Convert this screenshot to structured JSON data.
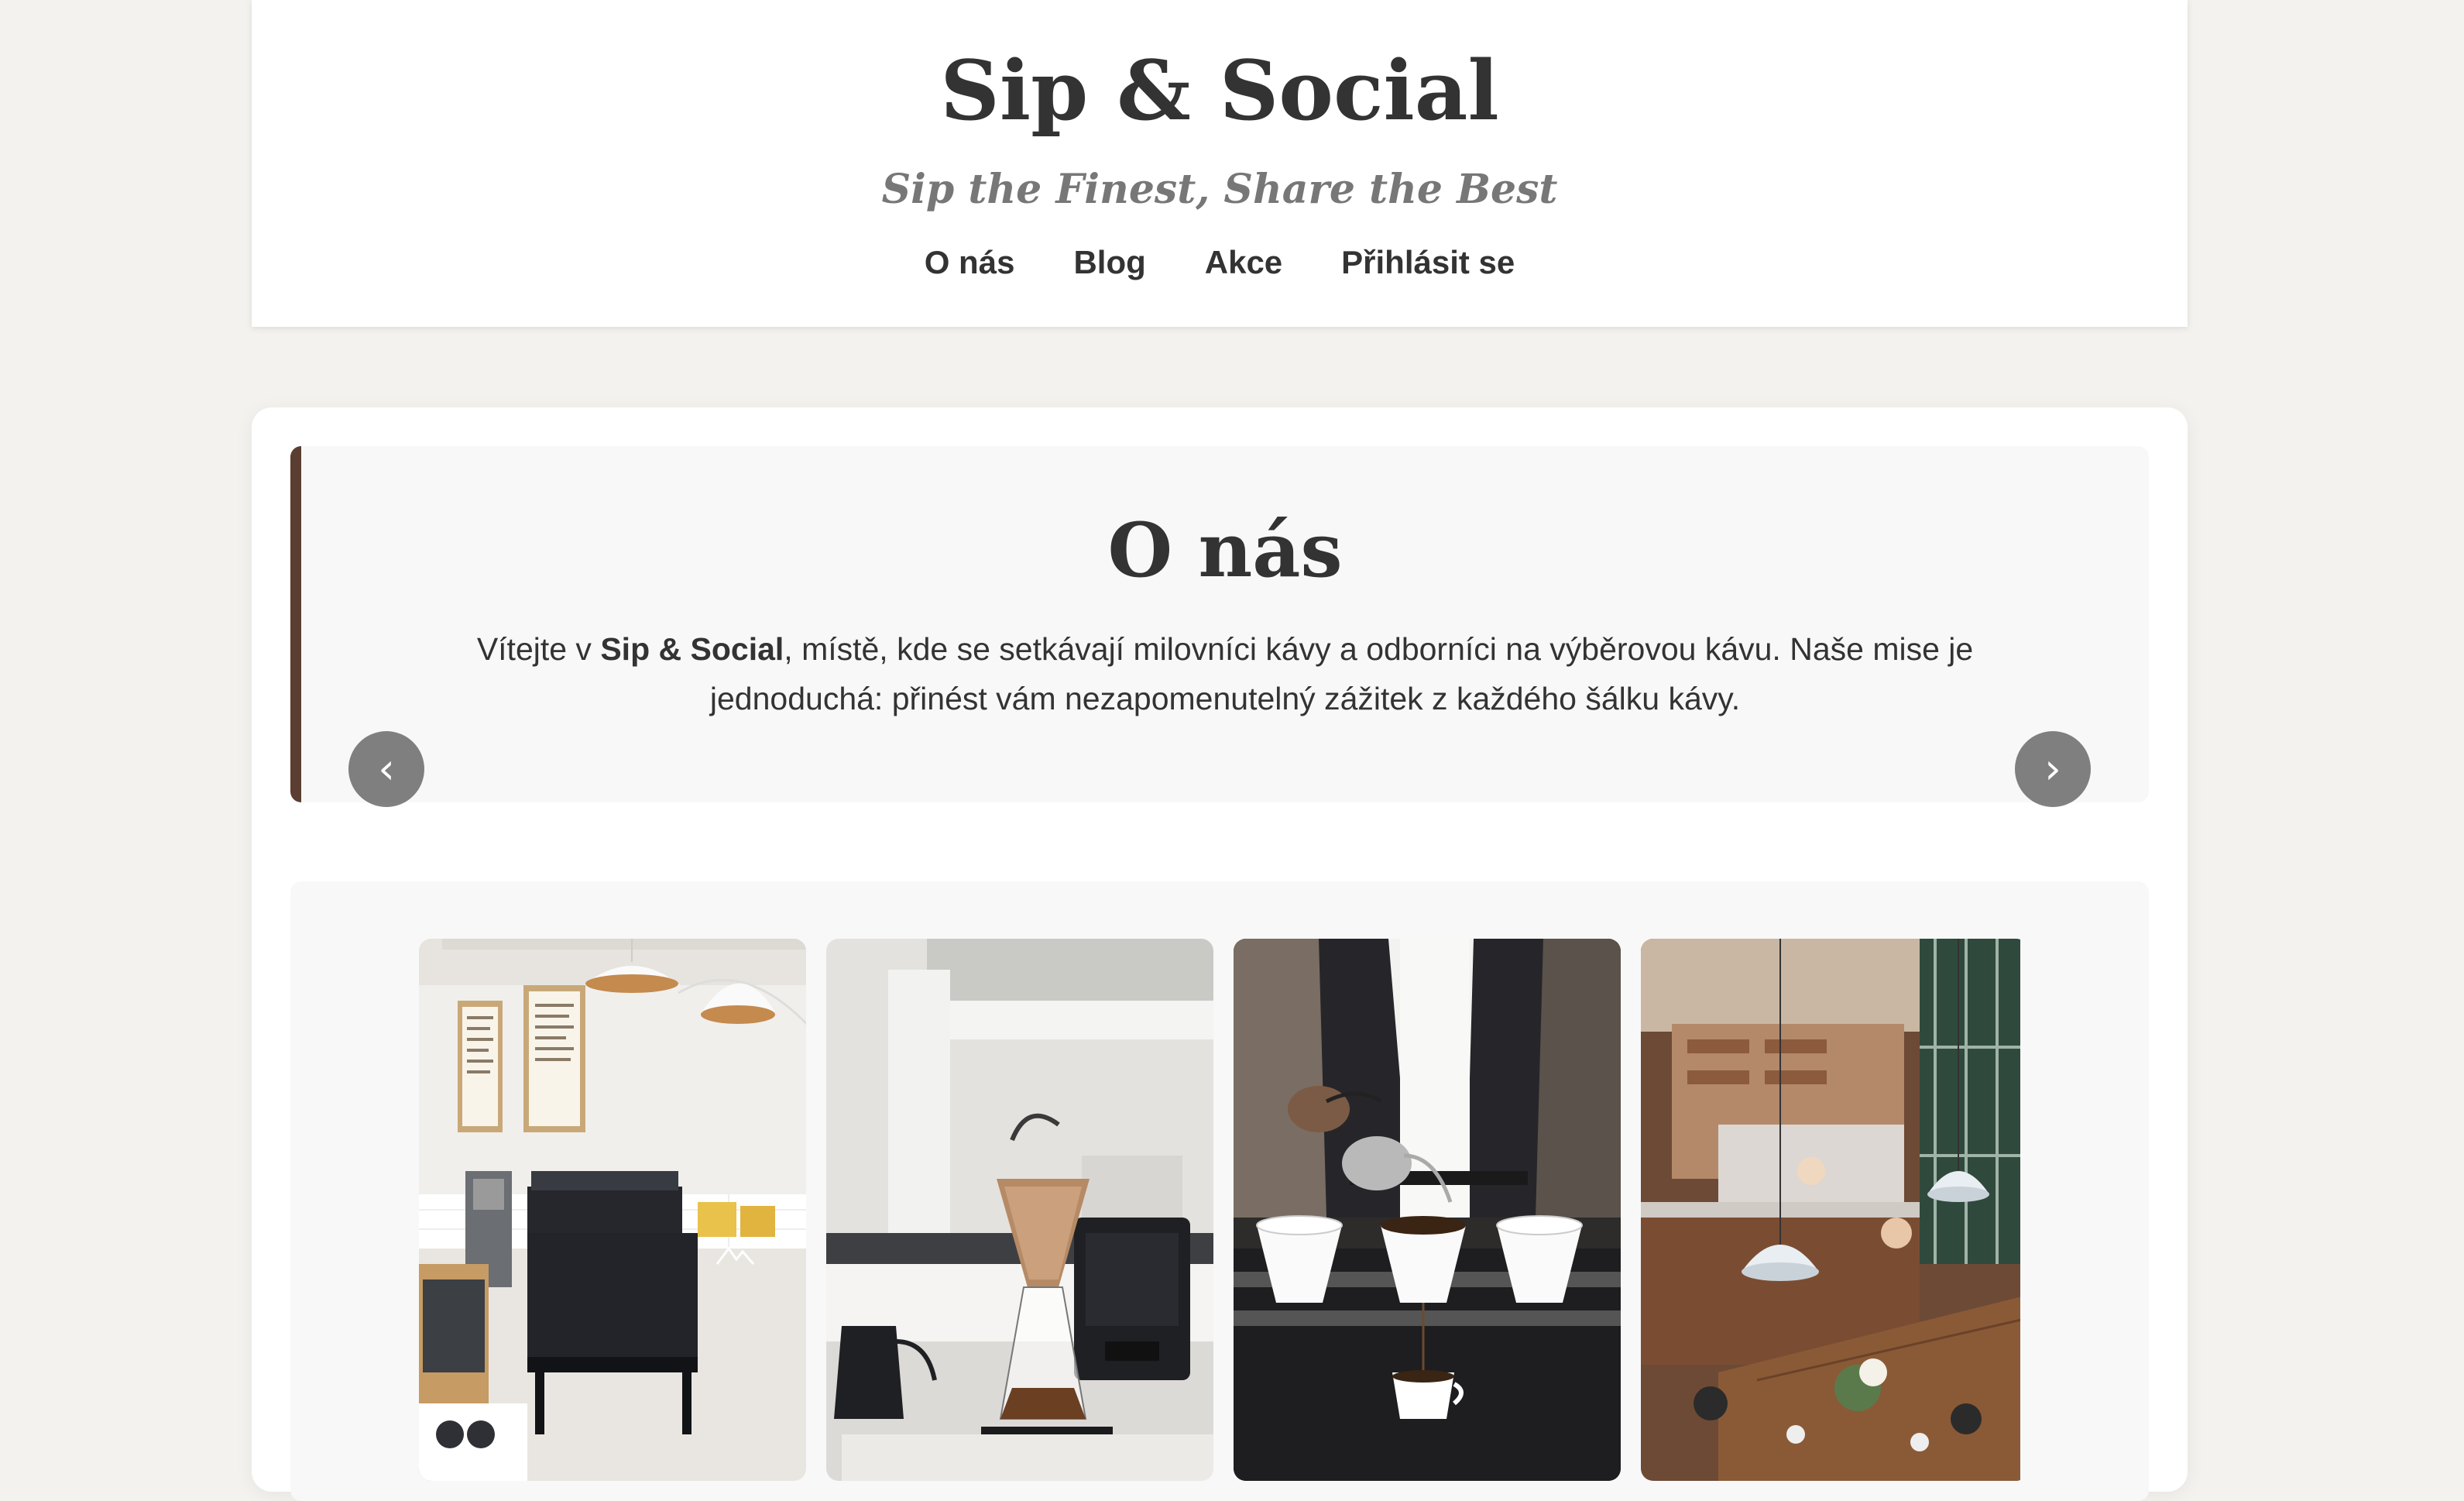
{
  "header": {
    "site_title": "Sip & Social",
    "tagline": "Sip the Finest, Share the Best",
    "nav": [
      {
        "label": "O nás"
      },
      {
        "label": "Blog"
      },
      {
        "label": "Akce"
      },
      {
        "label": "Přihlásit se"
      }
    ]
  },
  "about": {
    "title": "O nás",
    "text_before": "Vítejte v ",
    "brand": "Sip & Social",
    "text_after": ", místě, kde se setkávají milovníci kávy a odborníci na výběrovou kávu. Naše mise je jednoduchá: přinést vám nezapomenutelný zážitek z každého šálku kávy."
  },
  "carousel": {
    "prev_icon": "‹",
    "next_icon": "›",
    "slides": [
      {
        "subject": "cafe-counter-photo"
      },
      {
        "subject": "pour-over-brewing-photo"
      },
      {
        "subject": "barista-pouring-photo"
      },
      {
        "subject": "cafe-interior-aerial-photo"
      }
    ]
  },
  "colors": {
    "page_bg": "#f4f2ee",
    "accent_border": "#5b3e31",
    "text": "#333333",
    "tagline": "#777777"
  }
}
